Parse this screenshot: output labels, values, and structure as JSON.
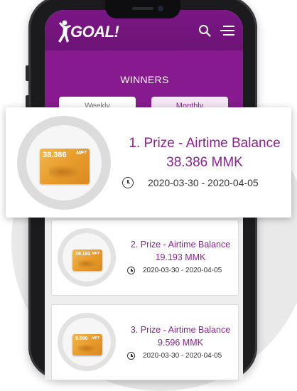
{
  "app": {
    "brand": "GOAL!"
  },
  "header": {
    "search_icon": "search-icon",
    "menu_icon": "hamburger-menu-icon"
  },
  "winners": {
    "title": "WINNERS"
  },
  "tabs": {
    "weekly": "Weekly",
    "monthly": "Monthly"
  },
  "colors": {
    "brand_purple": "#7a1785",
    "accent_text": "#8b2291",
    "voucher_gold": "#e79a2a"
  },
  "featured": {
    "title_line1": "1. Prize - Airtime Balance",
    "title_line2": "38.386 MMK",
    "date_range": "2020-03-30 - 2020-04-05",
    "voucher_amount": "38.386",
    "voucher_brand": "MPT"
  },
  "prizes": [
    {
      "title_line1": "2. Prize - Airtime Balance",
      "title_line2": "19.193 MMK",
      "date_range": "2020-03-30 - 2020-04-05",
      "voucher_amount": "19.193",
      "voucher_brand": "MPT"
    },
    {
      "title_line1": "3. Prize - Airtime Balance",
      "title_line2": "9.596 MMK",
      "date_range": "2020-03-30 - 2020-04-05",
      "voucher_amount": "9.596",
      "voucher_brand": "MPT"
    }
  ]
}
